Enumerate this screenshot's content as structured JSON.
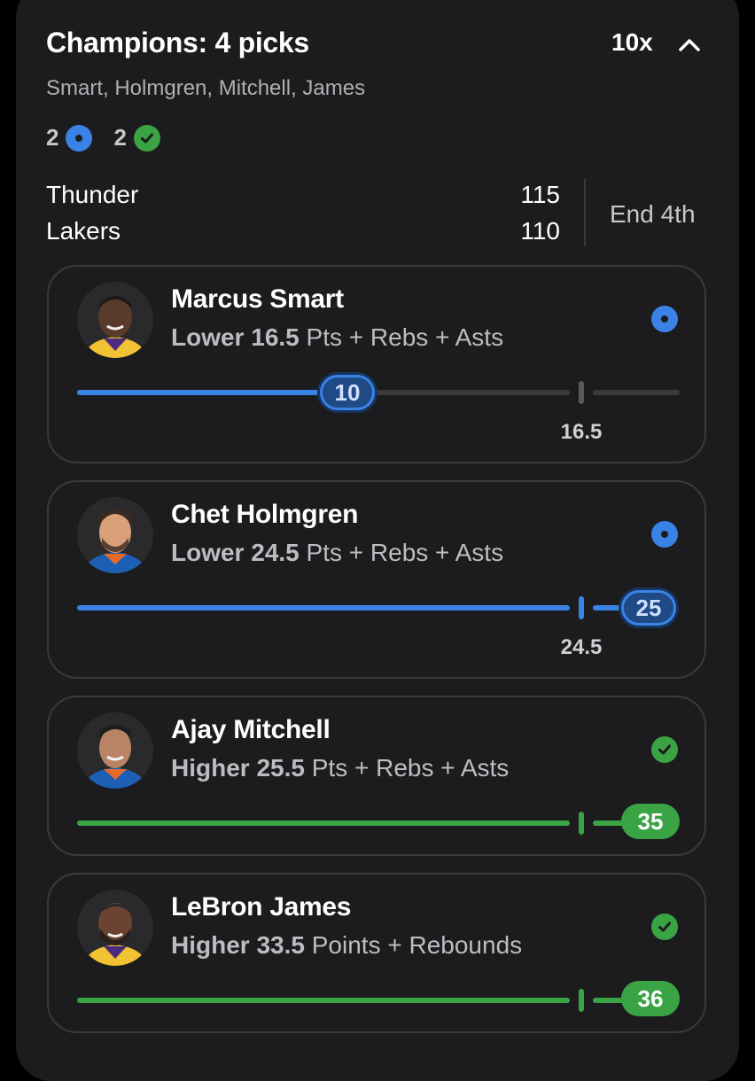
{
  "header": {
    "title": "Champions: 4 picks",
    "multiplier": "10x",
    "player_names": "Smart, Holmgren, Mitchell, James",
    "pending_count": "2",
    "won_count": "2"
  },
  "game": {
    "team1": "Thunder",
    "team1_score": "115",
    "team2": "Lakers",
    "team2_score": "110",
    "period": "End 4th"
  },
  "picks": [
    {
      "player": "Marcus Smart",
      "direction": "Lower",
      "line": "16.5",
      "stat": "Pts + Rebs + Asts",
      "current": "10",
      "status": "pending",
      "progress": 0.61
    },
    {
      "player": "Chet Holmgren",
      "direction": "Lower",
      "line": "24.5",
      "stat": "Pts + Rebs + Asts",
      "current": "25",
      "status": "pending",
      "progress": 1.0
    },
    {
      "player": "Ajay Mitchell",
      "direction": "Higher",
      "line": "25.5",
      "stat": "Pts + Rebs + Asts",
      "current": "35",
      "status": "won",
      "progress": 1.0
    },
    {
      "player": "LeBron James",
      "direction": "Higher",
      "line": "33.5",
      "stat": "Points + Rebounds",
      "current": "36",
      "status": "won",
      "progress": 1.0
    }
  ],
  "colors": {
    "pending": "#3b82e6",
    "won": "#3aa343",
    "card": "#1c1c1e",
    "track": "#3a3a3c"
  },
  "icons": {
    "collapse": "chevron-up-icon",
    "pending": "pending-dot-icon",
    "won": "checkmark-icon"
  }
}
